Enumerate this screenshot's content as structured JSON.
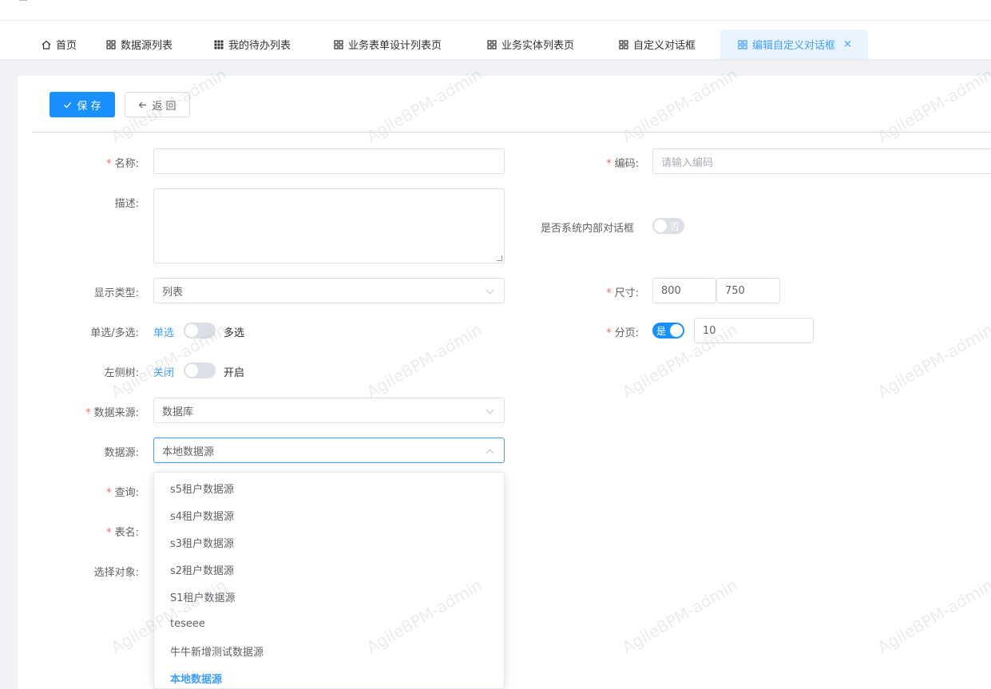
{
  "tabs": [
    {
      "label": "首页",
      "icon": "home-icon"
    },
    {
      "label": "数据源列表",
      "icon": "grid-icon"
    },
    {
      "label": "我的待办列表",
      "icon": "apps-icon"
    },
    {
      "label": "业务表单设计列表页",
      "icon": "grid-icon"
    },
    {
      "label": "业务实体列表页",
      "icon": "grid-icon"
    },
    {
      "label": "自定义对话框",
      "icon": "grid-icon"
    },
    {
      "label": "编辑自定义对话框",
      "icon": "grid-icon",
      "active": true,
      "close": "×"
    }
  ],
  "toolbar": {
    "save_label": "保 存",
    "back_label": "返 回"
  },
  "form": {
    "name": {
      "label": "名称:",
      "value": ""
    },
    "code": {
      "label": "编码:",
      "placeholder": "请输入编码"
    },
    "description": {
      "label": "描述:",
      "value": ""
    },
    "is_internal": {
      "label": "是否系统内部对话框",
      "switch_text": "否",
      "on": false
    },
    "display_type": {
      "label": "显示类型:",
      "value": "列表"
    },
    "size": {
      "label": "尺寸:",
      "width": "800",
      "height": "750"
    },
    "select_mode": {
      "label": "单选/多选:",
      "left": "单选",
      "right": "多选",
      "on": false
    },
    "pagination": {
      "label": "分页:",
      "switch_text": "是",
      "on": true,
      "page_size": "10"
    },
    "left_tree": {
      "label": "左侧树:",
      "left": "关闭",
      "right": "开启",
      "on": false
    },
    "data_source_type": {
      "label": "数据来源:",
      "value": "数据库"
    },
    "data_source": {
      "label": "数据源:",
      "value": "本地数据源"
    },
    "query": {
      "label": "查询:"
    },
    "table_name": {
      "label": "表名:"
    },
    "select_object": {
      "label": "选择对象:"
    }
  },
  "dropdown": {
    "options": [
      "s5租户数据源",
      "s4租户数据源",
      "s3租户数据源",
      "s2租户数据源",
      "S1租户数据源",
      "teseee",
      "牛牛新增测试数据源",
      "本地数据源"
    ],
    "selected": "本地数据源"
  },
  "watermark": "AgileBPM-admin",
  "colors": {
    "primary": "#1890ff",
    "required": "#f56c6c",
    "active_text": "#409eff"
  }
}
